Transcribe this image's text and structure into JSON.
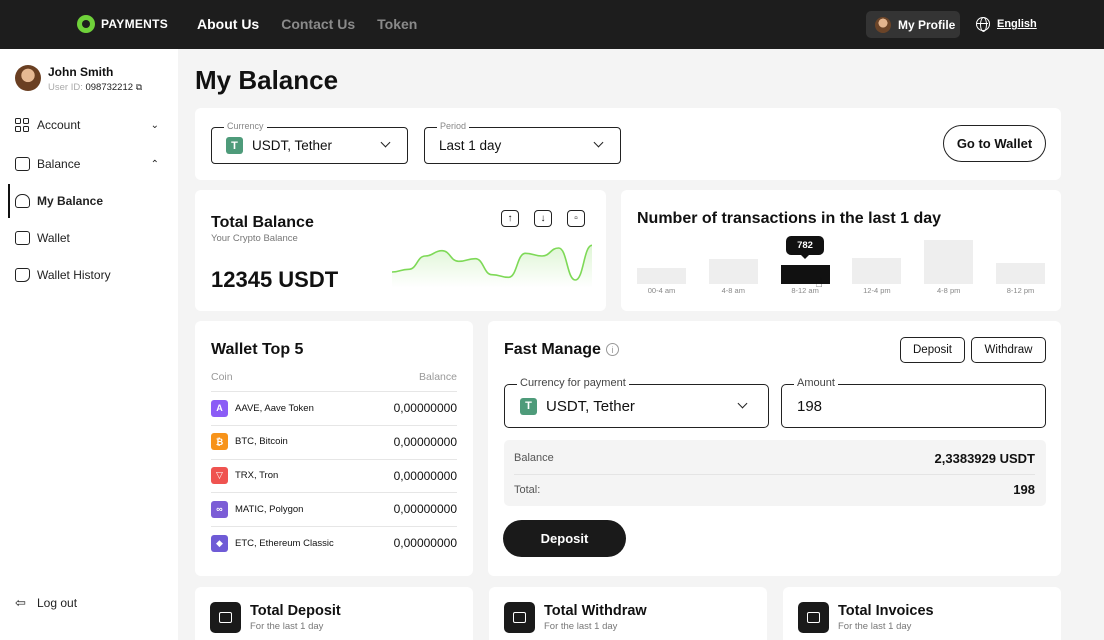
{
  "topbar": {
    "logo_text": "PAYMENTS",
    "nav": [
      "About Us",
      "Contact Us",
      "Token"
    ],
    "profile_label": "My Profile",
    "language": "English"
  },
  "sidebar": {
    "user_name": "John Smith",
    "user_id_label": "User ID:",
    "user_id": "098732212",
    "items": [
      {
        "label": "Account"
      },
      {
        "label": "Balance"
      },
      {
        "label": "My Balance"
      },
      {
        "label": "Wallet"
      },
      {
        "label": "Wallet History"
      }
    ],
    "logout": "Log out"
  },
  "main": {
    "title": "My Balance",
    "filters": {
      "currency_label": "Currency",
      "currency_value": "USDT, Tether",
      "period_label": "Period",
      "period_value": "Last 1 day",
      "wallet_button": "Go to Wallet"
    },
    "total_balance": {
      "title": "Total Balance",
      "subtitle": "Your Crypto Balance",
      "amount": "12345 USDT",
      "sparkline": [
        12,
        14,
        24,
        28,
        20,
        22,
        10,
        8,
        26,
        24,
        30,
        6,
        32
      ],
      "accent": "#7ed957"
    },
    "transactions": {
      "title": "Number of transactions in the last 1 day",
      "tooltip": "782"
    },
    "wallet_top": {
      "title": "Wallet Top 5",
      "col_coin": "Coin",
      "col_balance": "Balance",
      "rows": [
        {
          "coin": "AAVE, Aave Token",
          "balance": "0,00000000",
          "color": "#8b5cf6",
          "glyph": "A"
        },
        {
          "coin": "BTC, Bitcoin",
          "balance": "0,00000000",
          "color": "#f7931a",
          "glyph": "₿"
        },
        {
          "coin": "TRX, Tron",
          "balance": "0,00000000",
          "color": "#ef5350",
          "glyph": "▽"
        },
        {
          "coin": "MATIC, Polygon",
          "balance": "0,00000000",
          "color": "#7b5cd6",
          "glyph": "∞"
        },
        {
          "coin": "ETC, Ethereum Classic",
          "balance": "0,00000000",
          "color": "#6f5bd6",
          "glyph": "◆"
        }
      ]
    },
    "fast_manage": {
      "title": "Fast Manage",
      "deposit_tab": "Deposit",
      "withdraw_tab": "Withdraw",
      "currency_label": "Currency for payment",
      "currency_value": "USDT, Tether",
      "amount_label": "Amount",
      "amount_value": "198",
      "balance_label": "Balance",
      "balance_value": "2,3383929 USDT",
      "total_label": "Total:",
      "total_value": "198",
      "submit": "Deposit"
    },
    "stats": [
      {
        "title": "Total Deposit",
        "subtitle": "For the last 1 day"
      },
      {
        "title": "Total Withdraw",
        "subtitle": "For the last 1 day"
      },
      {
        "title": "Total Invoices",
        "subtitle": "For the last 1 day"
      }
    ]
  },
  "chart_data": {
    "type": "bar",
    "categories": [
      "00-4 am",
      "4-8 am",
      "8-12 am",
      "12-4 pm",
      "4-8 pm",
      "8-12 pm"
    ],
    "values": [
      240,
      380,
      782,
      390,
      660,
      310
    ],
    "highlight": "8-12 am",
    "title": "Number of transactions in the last 1 day"
  }
}
